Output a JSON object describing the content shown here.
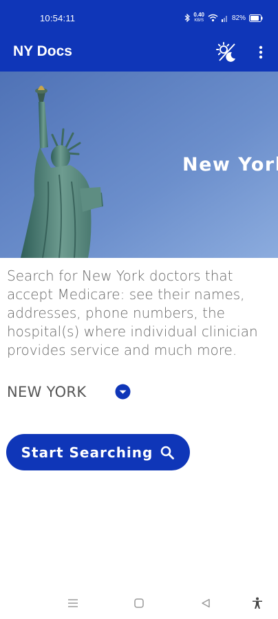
{
  "status_bar": {
    "time": "10:54:11",
    "data_speed": "0.40",
    "data_unit": "KB/S",
    "battery": "82%"
  },
  "app_bar": {
    "title": "NY Docs",
    "theme_icon": "theme-toggle-icon",
    "menu_icon": "more-vert-icon"
  },
  "hero": {
    "title": "New York",
    "image": "statue-of-liberty"
  },
  "description": "Search for New York doctors that accept Medicare: see their names, addresses, phone numbers, the hospital(s) where individual clinician provides service and much more.",
  "state_selector": {
    "selected": "NEW YORK",
    "icon": "chevron-down-circle-icon"
  },
  "search_button": {
    "label": "Start Searching",
    "icon": "search-icon"
  },
  "nav_bar": {
    "items": [
      "menu-icon",
      "home-icon",
      "back-icon",
      "accessibility-icon"
    ]
  },
  "colors": {
    "primary": "#0f36b8",
    "text": "#666666",
    "background": "#ffffff"
  }
}
